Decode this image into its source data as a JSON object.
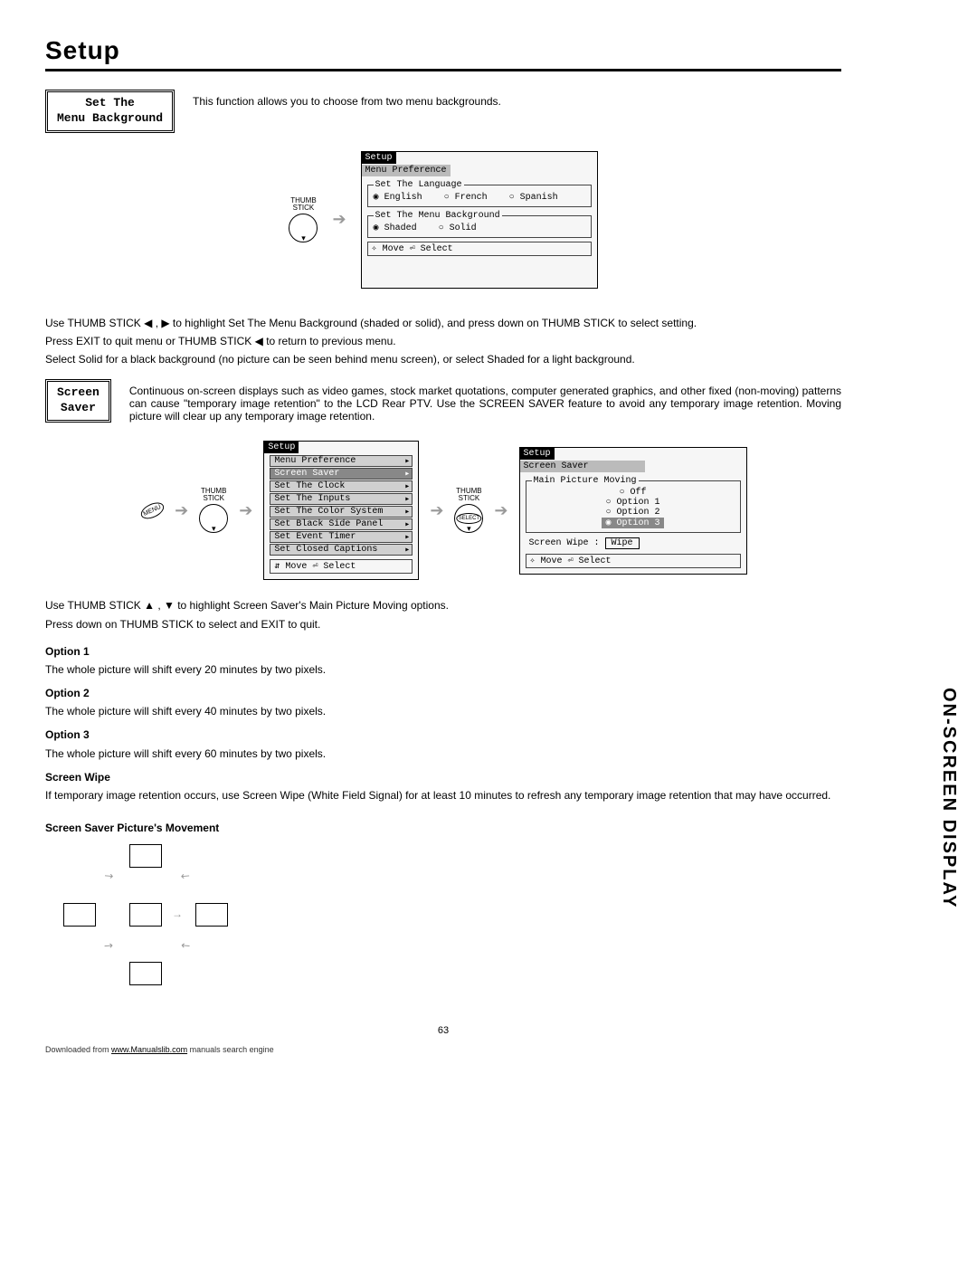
{
  "title": "Setup",
  "sideTab": "ON-SCREEN DISPLAY",
  "pageNumber": "63",
  "footer": {
    "prefix": "Downloaded from ",
    "link": "www.Manualslib.com",
    "suffix": " manuals search engine"
  },
  "section1": {
    "label": "Set The\nMenu Background",
    "intro": "This function allows you to choose from two menu backgrounds.",
    "thumbLabel": "THUMB\nSTICK",
    "osd": {
      "title": "Setup",
      "sub": "Menu Preference",
      "langLegend": "Set The Language",
      "langs": [
        "◉ English",
        "○ French",
        "○ Spanish"
      ],
      "bgLegend": "Set The Menu Background",
      "bgs": [
        "◉ Shaded",
        "○ Solid"
      ],
      "hint": "✧ Move  ⏎ Select"
    },
    "instr1": "Use THUMB STICK ◀ , ▶ to highlight Set The Menu Background (shaded or solid), and press down on THUMB STICK to select setting.",
    "instr2": "Press EXIT to quit menu or THUMB STICK ◀ to return to previous menu.",
    "instr3": "Select Solid for a black background (no picture can be seen behind menu screen), or select Shaded for a light background."
  },
  "section2": {
    "label": "Screen\nSaver",
    "intro": "Continuous on-screen displays such as video games, stock market quotations, computer generated graphics, and other fixed (non-moving) patterns can cause \"temporary image retention\" to the LCD Rear PTV.  Use the SCREEN SAVER feature to avoid any temporary image retention.  Moving picture will clear up any temporary image retention.",
    "thumbLabel": "THUMB\nSTICK",
    "menuBadge": "MENU",
    "selectBadge": "SELECT",
    "osd1": {
      "title": "Setup",
      "items": [
        "Menu Preference",
        "Screen Saver",
        "Set The Clock",
        "Set The Inputs",
        "Set The Color System",
        "Set Black Side Panel",
        "Set Event Timer",
        "Set Closed Captions"
      ],
      "selectedIndex": 1,
      "hint": "⇵ Move  ⏎ Select"
    },
    "osd2": {
      "title": "Setup",
      "sub": "Screen Saver",
      "legend": "Main Picture Moving",
      "options": [
        "○ Off",
        "○ Option 1",
        "○ Option 2",
        "◉ Option 3"
      ],
      "wipeLabel": "Screen Wipe :",
      "wipeBtn": "Wipe",
      "hint": "✧ Move  ⏎ Select"
    },
    "instrA": "Use THUMB STICK ▲ , ▼ to highlight Screen Saver's Main Picture Moving options.",
    "instrB": "Press down on THUMB STICK to select and EXIT to quit.",
    "opt1h": "Option 1",
    "opt1t": "The whole picture will shift every 20 minutes by two pixels.",
    "opt2h": "Option 2",
    "opt2t": "The whole picture will shift every 40 minutes by two pixels.",
    "opt3h": "Option 3",
    "opt3t": "The whole picture will shift every 60 minutes by two pixels.",
    "wipeh": "Screen Wipe",
    "wipet": "If temporary image retention occurs, use Screen Wipe (White Field Signal) for at least 10 minutes to refresh any temporary image retention that may have occurred.",
    "moveh": "Screen Saver Picture's Movement"
  }
}
